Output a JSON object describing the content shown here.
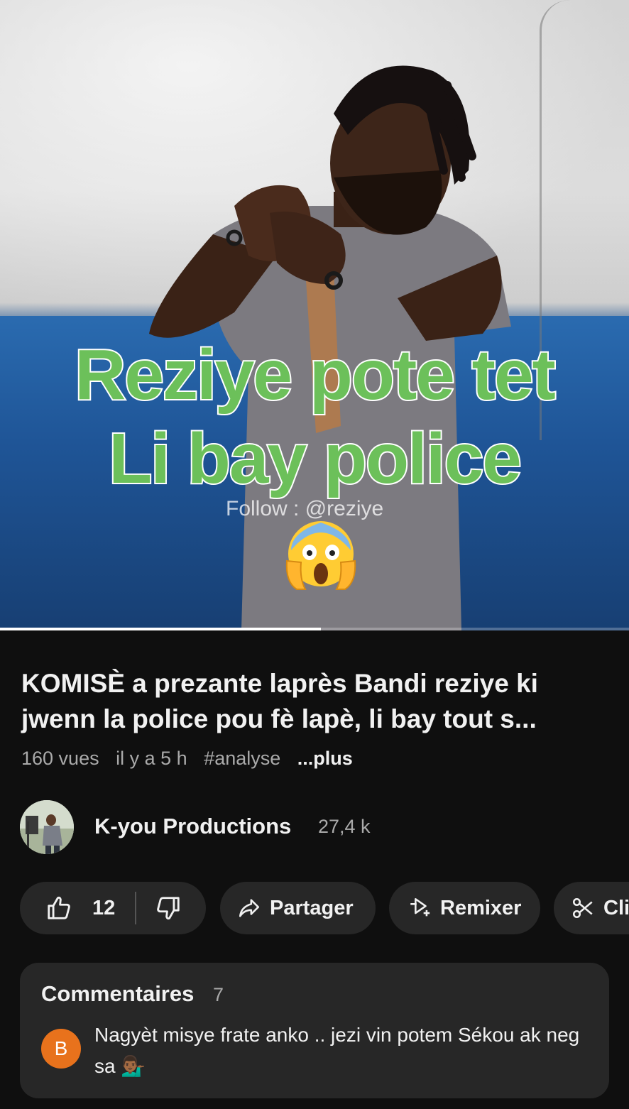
{
  "video": {
    "overlay_line1": "Reziye pote tet",
    "overlay_line2": "Li bay police",
    "watermark": "Follow : @reziye",
    "emoji": "face-screaming-in-fear",
    "progress": 0.51
  },
  "info": {
    "title": "KOMISÈ a prezante laprès Bandi reziye ki jwenn la police pou fè lapè, li bay tout s...",
    "views": "160 vues",
    "age": "il y a 5 h",
    "hashtag": "#analyse",
    "more": "...plus"
  },
  "channel": {
    "name": "K-you Productions",
    "subscribers": "27,4 k"
  },
  "actions": {
    "likes": "12",
    "share": "Partager",
    "remix": "Remixer",
    "clip": "Cli"
  },
  "comments": {
    "heading": "Commentaires",
    "count": "7",
    "first": {
      "avatar_letter": "B",
      "avatar_color": "#e8721c",
      "text": "Nagyèt misye frate anko .. jezi vin potem Sékou ak neg sa 💁🏾‍♂️"
    }
  },
  "colors": {
    "overlay_text": "#6cc05a",
    "background": "#0f0f0f",
    "pill": "#272727"
  }
}
